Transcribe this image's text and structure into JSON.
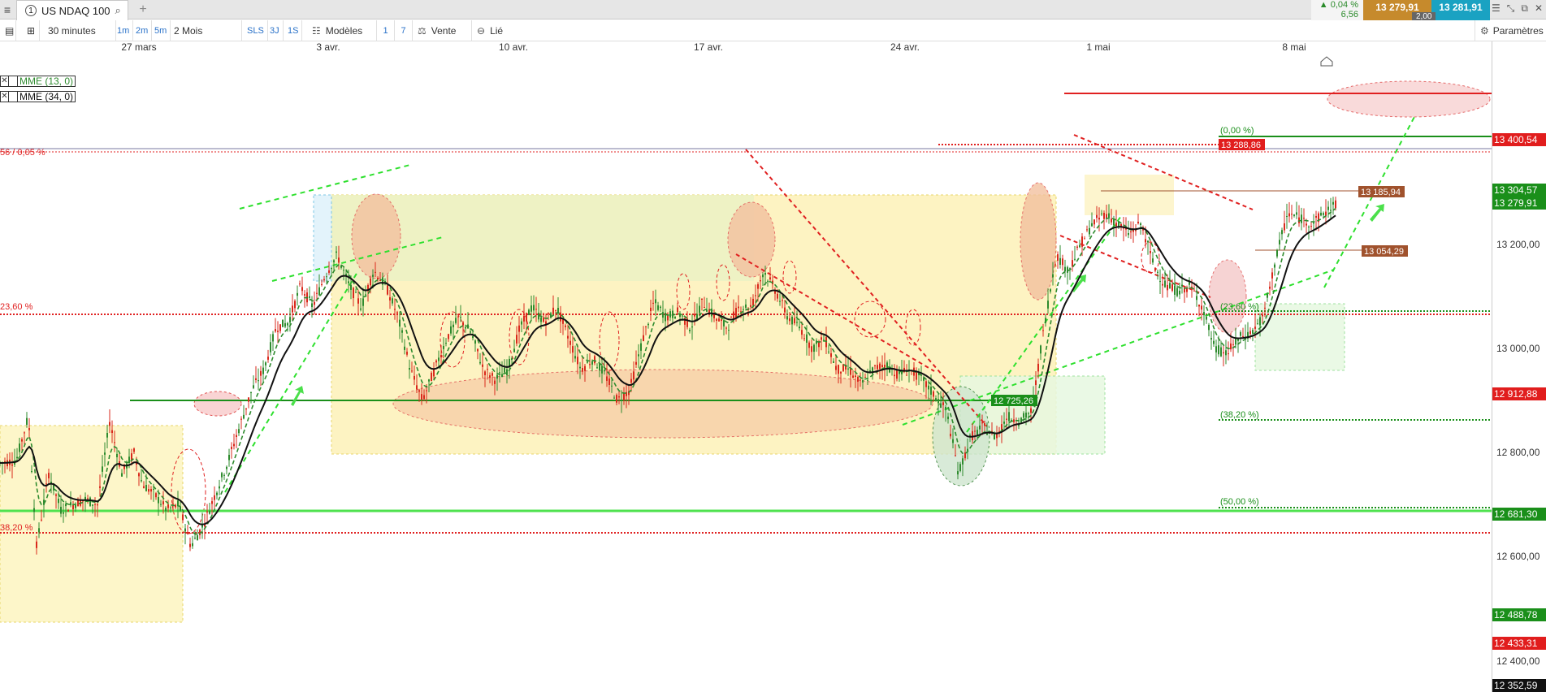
{
  "tabbar": {
    "instrument_index": "1",
    "instrument_name": "US NDAQ 100",
    "var_pct": "▲ 0,04 %",
    "var_abs": "6,56",
    "bid": "13 279,91",
    "spread": "2,00",
    "ask": "13 281,91"
  },
  "toolbar": {
    "interval": "30 minutes",
    "period": "2 Mois",
    "quick_intervals": [
      "1m",
      "2m",
      "5m"
    ],
    "quick_orders": [
      "SLS",
      "3J",
      "1S"
    ],
    "models": "Modèles",
    "days": [
      "1",
      "7"
    ],
    "sell": "Vente",
    "linked": "Lié",
    "settings": "Paramètres"
  },
  "date_axis": [
    "27 mars",
    "3 avr.",
    "10 avr.",
    "17 avr.",
    "24 avr.",
    "1 mai",
    "8 mai"
  ],
  "legend": [
    "MME (13, 0)",
    "MME (34, 0)"
  ],
  "colors": {
    "bull": "#2e8b2e",
    "bear": "#d9291c",
    "fib": "#1e8c1e",
    "orange_tag": "#a0522d"
  },
  "chart_data": {
    "type": "line",
    "title": "",
    "instrument": "US NDAQ 100",
    "ylim": [
      12340,
      13590
    ],
    "y_ticks": [
      13200,
      13000,
      12800,
      12600,
      12400
    ],
    "y_tick_labels": [
      "13 200,00",
      "13 000,00",
      "12 800,00",
      "12 600,00",
      "12 400,00"
    ],
    "last_price": 13279.91,
    "price_tags": [
      {
        "label": "13 400,54",
        "value": 13400.54,
        "color": "#e11d1d"
      },
      {
        "label": "13 304,57",
        "value": 13304.57,
        "color": "#1a8f1a"
      },
      {
        "label": "13 279,91",
        "value": 13279.91,
        "color": "#1a8f1a"
      },
      {
        "label": "12 912,88",
        "value": 12912.88,
        "color": "#e11d1d"
      },
      {
        "label": "12 681,30",
        "value": 12681.3,
        "color": "#1a8f1a"
      },
      {
        "label": "12 488,78",
        "value": 12488.78,
        "color": "#1a8f1a"
      },
      {
        "label": "12 433,31",
        "value": 12433.31,
        "color": "#e11d1d"
      },
      {
        "label": "12 352,59",
        "value": 12352.59,
        "color": "#111111"
      }
    ],
    "in_chart_tags": [
      {
        "label": "13 288,86",
        "value": 13288.86,
        "color": "#e11d1d"
      },
      {
        "label": "13 185,94",
        "value": 13185.94,
        "color": "#a0522d"
      },
      {
        "label": "13 054,29",
        "value": 13054.29,
        "color": "#a0522d"
      },
      {
        "label": "12 725,26",
        "value": 12725.26,
        "color": "#1a8f1a"
      }
    ],
    "fib_labels": [
      "(0,00 %)",
      "(23,60 %)",
      "(38,20 %)",
      "(50,00 %)"
    ],
    "left_fib_labels": [
      "56 / 0,05 %",
      "23,60 %",
      "38,20 %"
    ],
    "series": [
      {
        "name": "MME (13, 0)",
        "color": "#2e8b2e"
      },
      {
        "name": "MME (34, 0)",
        "color": "#111111"
      }
    ],
    "price_path": [
      [
        0,
        12780
      ],
      [
        20,
        12785
      ],
      [
        35,
        12870
      ],
      [
        45,
        12620
      ],
      [
        60,
        12760
      ],
      [
        75,
        12690
      ],
      [
        90,
        12700
      ],
      [
        105,
        12710
      ],
      [
        120,
        12700
      ],
      [
        135,
        12860
      ],
      [
        150,
        12760
      ],
      [
        165,
        12800
      ],
      [
        175,
        12740
      ],
      [
        190,
        12720
      ],
      [
        205,
        12690
      ],
      [
        220,
        12700
      ],
      [
        235,
        12620
      ],
      [
        250,
        12660
      ],
      [
        265,
        12720
      ],
      [
        280,
        12780
      ],
      [
        295,
        12850
      ],
      [
        310,
        12920
      ],
      [
        325,
        12960
      ],
      [
        340,
        13040
      ],
      [
        355,
        13050
      ],
      [
        370,
        13120
      ],
      [
        385,
        13080
      ],
      [
        400,
        13140
      ],
      [
        415,
        13180
      ],
      [
        430,
        13120
      ],
      [
        445,
        13080
      ],
      [
        460,
        13150
      ],
      [
        475,
        13120
      ],
      [
        490,
        13060
      ],
      [
        505,
        12960
      ],
      [
        520,
        12900
      ],
      [
        535,
        12960
      ],
      [
        550,
        13020
      ],
      [
        565,
        13060
      ],
      [
        580,
        13030
      ],
      [
        595,
        12960
      ],
      [
        610,
        12940
      ],
      [
        625,
        12960
      ],
      [
        640,
        13040
      ],
      [
        655,
        13080
      ],
      [
        670,
        13050
      ],
      [
        685,
        13080
      ],
      [
        700,
        13020
      ],
      [
        715,
        12960
      ],
      [
        730,
        12980
      ],
      [
        745,
        12950
      ],
      [
        760,
        12900
      ],
      [
        775,
        12920
      ],
      [
        790,
        13010
      ],
      [
        805,
        13090
      ],
      [
        820,
        13060
      ],
      [
        835,
        13070
      ],
      [
        850,
        13040
      ],
      [
        865,
        13090
      ],
      [
        880,
        13060
      ],
      [
        895,
        13040
      ],
      [
        910,
        13080
      ],
      [
        925,
        13080
      ],
      [
        940,
        13150
      ],
      [
        955,
        13110
      ],
      [
        970,
        13060
      ],
      [
        985,
        13040
      ],
      [
        1000,
        13000
      ],
      [
        1015,
        13020
      ],
      [
        1030,
        12960
      ],
      [
        1045,
        12960
      ],
      [
        1060,
        12930
      ],
      [
        1075,
        12960
      ],
      [
        1090,
        12970
      ],
      [
        1105,
        12950
      ],
      [
        1120,
        12960
      ],
      [
        1135,
        12940
      ],
      [
        1150,
        12910
      ],
      [
        1165,
        12880
      ],
      [
        1180,
        12760
      ],
      [
        1195,
        12830
      ],
      [
        1210,
        12850
      ],
      [
        1225,
        12830
      ],
      [
        1240,
        12870
      ],
      [
        1255,
        12860
      ],
      [
        1270,
        12880
      ],
      [
        1285,
        13040
      ],
      [
        1300,
        13180
      ],
      [
        1315,
        13150
      ],
      [
        1330,
        13200
      ],
      [
        1345,
        13240
      ],
      [
        1360,
        13260
      ],
      [
        1375,
        13240
      ],
      [
        1390,
        13220
      ],
      [
        1405,
        13240
      ],
      [
        1420,
        13160
      ],
      [
        1435,
        13120
      ],
      [
        1450,
        13110
      ],
      [
        1465,
        13120
      ],
      [
        1480,
        13080
      ],
      [
        1495,
        13000
      ],
      [
        1510,
        12990
      ],
      [
        1525,
        13020
      ],
      [
        1540,
        13030
      ],
      [
        1555,
        13060
      ],
      [
        1570,
        13170
      ],
      [
        1585,
        13260
      ],
      [
        1600,
        13250
      ],
      [
        1615,
        13240
      ],
      [
        1630,
        13260
      ],
      [
        1645,
        13280
      ]
    ]
  }
}
